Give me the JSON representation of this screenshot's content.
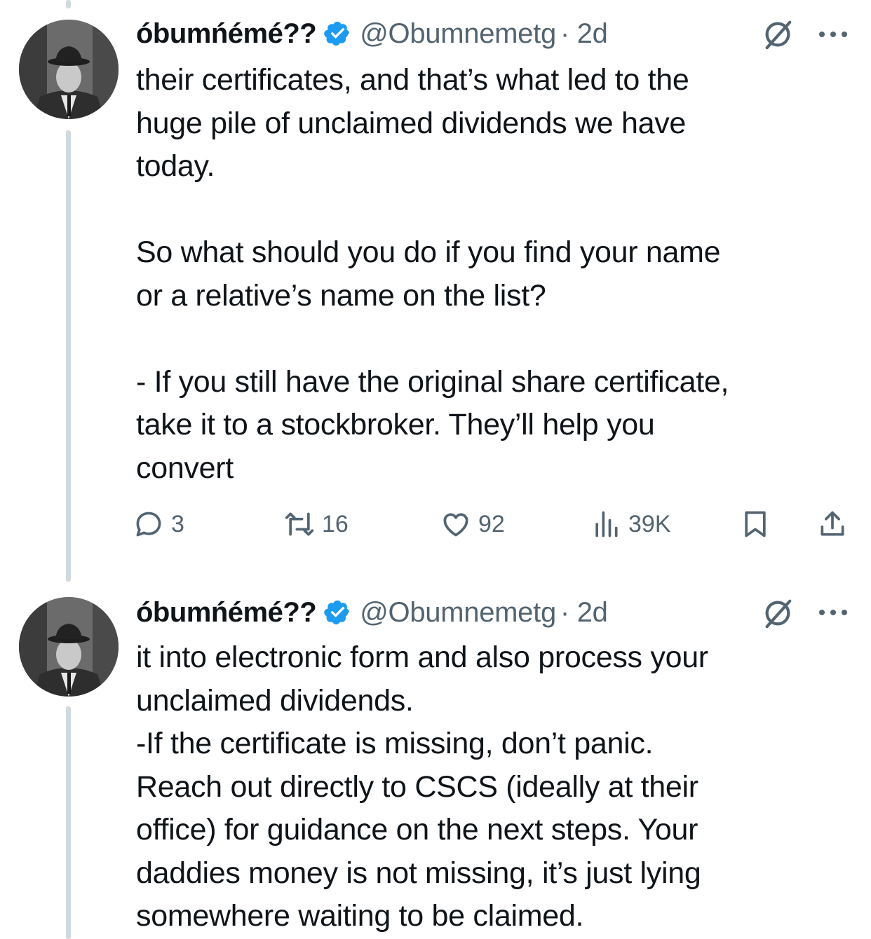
{
  "tweets": [
    {
      "display_name": "óbumńémé??",
      "handle": "@Obumnemetg",
      "time": "· 2d",
      "text": "their certificates, and that’s what led to the\nhuge pile of unclaimed dividends we have\ntoday.\n\nSo what should you do if you find your name\nor a relative’s name on the list?\n\n- If you still have the original share certificate,\ntake it to a stockbroker. They’ll help you\nconvert",
      "stats": {
        "replies": "3",
        "reposts": "16",
        "likes": "92",
        "views": "39K"
      }
    },
    {
      "display_name": "óbumńémé??",
      "handle": "@Obumnemetg",
      "time": "· 2d",
      "text": "it into electronic form and also process your\nunclaimed dividends.\n-If the certificate is missing, don’t panic.\nReach out directly to CSCS (ideally at their\noffice) for guidance on the next steps. Your\ndaddies money is not missing, it’s just lying\nsomewhere waiting to be claimed."
    }
  ],
  "colors": {
    "verified": "#1d9bf0",
    "secondary_text": "#536471",
    "thread_line": "#cfd9de"
  },
  "icons": [
    "verified-badge-icon",
    "grok-icon",
    "more-icon",
    "reply-icon",
    "repost-icon",
    "like-icon",
    "views-icon",
    "bookmark-icon",
    "share-icon"
  ]
}
